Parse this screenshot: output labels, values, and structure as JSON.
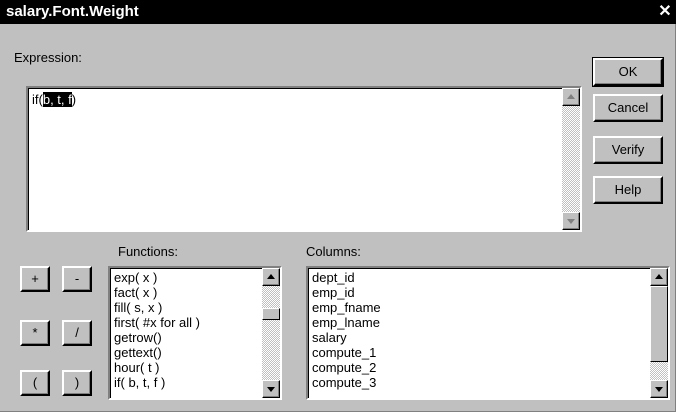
{
  "dialog": {
    "title": "salary.Font.Weight",
    "close_glyph": "✕"
  },
  "expression": {
    "label": "Expression:",
    "prefix": "if(",
    "selected": "b, t, f",
    "suffix": ")"
  },
  "buttons": {
    "ok": "OK",
    "cancel": "Cancel",
    "verify": "Verify",
    "help": "Help"
  },
  "operators": [
    "+",
    "-",
    "*",
    "/",
    "(",
    ")"
  ],
  "functions": {
    "label": "Functions:",
    "items": [
      "exp( x )",
      "fact( x )",
      "fill( s, x )",
      "first( #x for all )",
      "getrow()",
      "gettext()",
      "hour( t )",
      "if( b, t, f )"
    ]
  },
  "columns": {
    "label": "Columns:",
    "items": [
      "dept_id",
      "emp_id",
      "emp_fname",
      "emp_lname",
      "salary",
      "compute_1",
      "compute_2",
      "compute_3"
    ]
  }
}
